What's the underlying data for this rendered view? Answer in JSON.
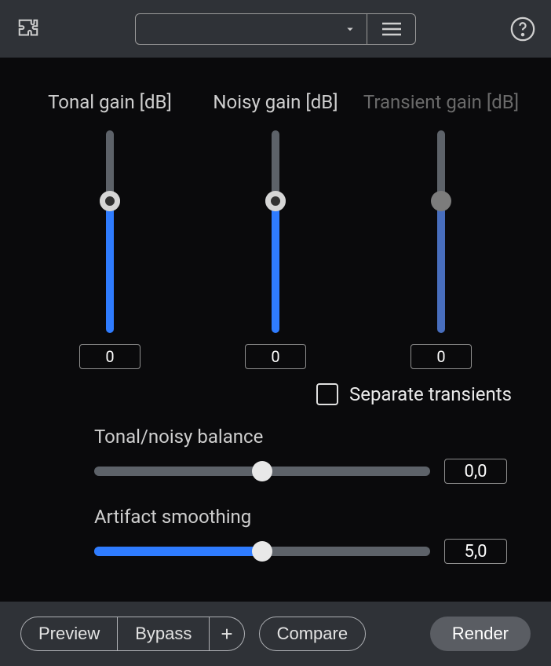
{
  "toolbar": {
    "preset_value": ""
  },
  "gains": {
    "tonal": {
      "label": "Tonal gain [dB]",
      "value": "0",
      "fill_pct": 65,
      "disabled": false
    },
    "noisy": {
      "label": "Noisy gain [dB]",
      "value": "0",
      "fill_pct": 65,
      "disabled": false
    },
    "transient": {
      "label": "Transient gain [dB]",
      "value": "0",
      "fill_pct": 65,
      "disabled": true
    }
  },
  "separate_transients": {
    "label": "Separate transients",
    "checked": false
  },
  "balance": {
    "label": "Tonal/noisy balance",
    "value": "0,0",
    "fill_pct": 50
  },
  "smoothing": {
    "label": "Artifact smoothing",
    "value": "5,0",
    "fill_pct": 50
  },
  "buttons": {
    "preview": "Preview",
    "bypass": "Bypass",
    "plus": "+",
    "compare": "Compare",
    "render": "Render"
  }
}
